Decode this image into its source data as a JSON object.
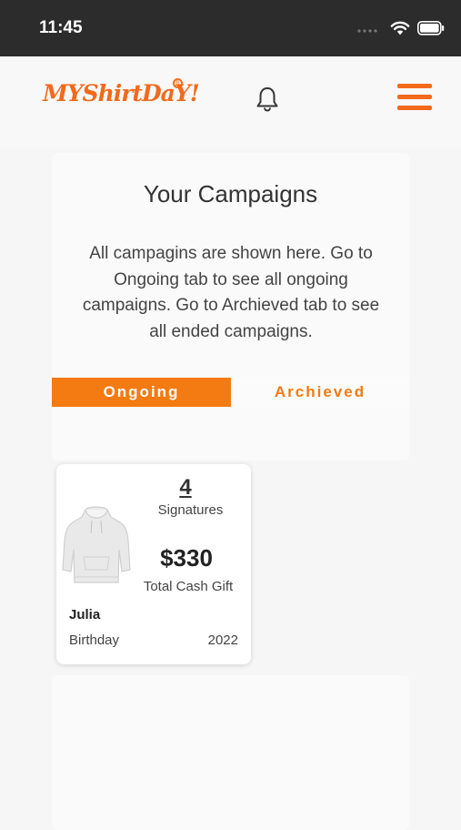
{
  "status_bar": {
    "time": "11:45",
    "icons": [
      "signal-dots-icon",
      "wifi-icon",
      "battery-icon"
    ]
  },
  "header": {
    "logo_text": "MYShirtDaY!",
    "logo_mark": "R",
    "notification_icon": "bell-icon",
    "menu_icon": "hamburger-menu-icon",
    "accent_color": "#f26a1b"
  },
  "campaigns": {
    "title": "Your Campaigns",
    "description": "All campagins are shown here. Go to Ongoing tab to see all ongoing campaigns. Go to Archieved tab to see all ended campaigns.",
    "tabs": [
      {
        "label": "Ongoing",
        "active": true
      },
      {
        "label": "Archieved",
        "active": false
      }
    ]
  },
  "campaign_cards": [
    {
      "image_icon": "hoodie-icon",
      "signatures_count": "4",
      "signatures_label": "Signatures",
      "amount": "$330",
      "amount_label": "Total Cash Gift",
      "recipient": "Julia",
      "occasion": "Birthday",
      "year": "2022"
    }
  ]
}
